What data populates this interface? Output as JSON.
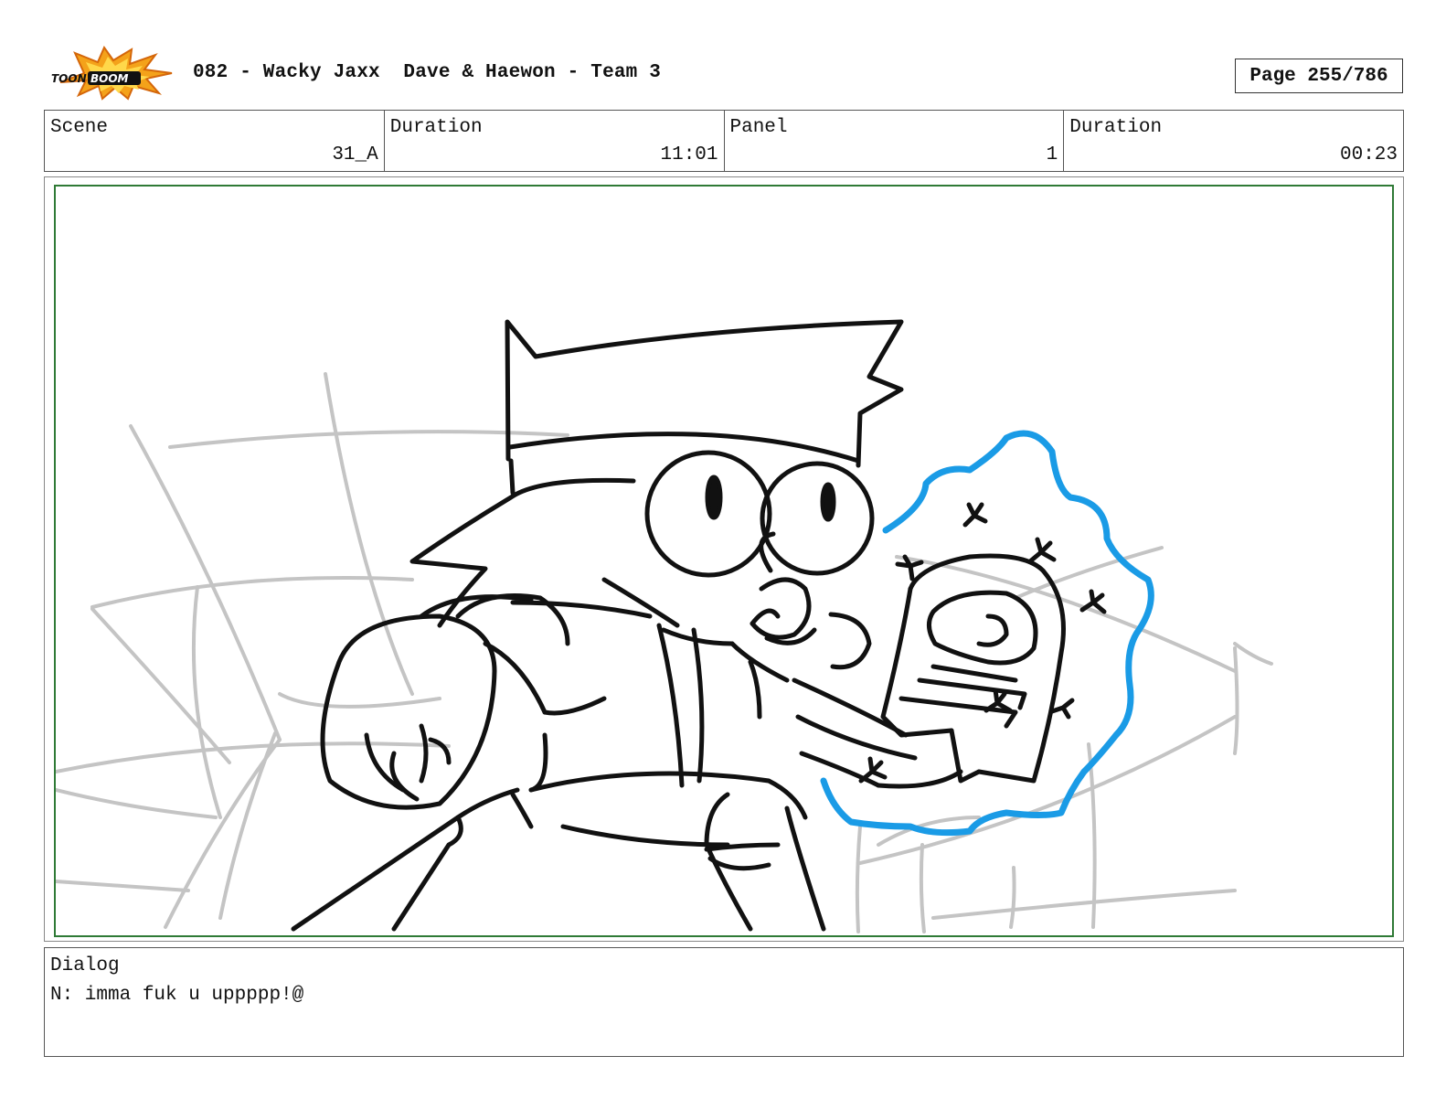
{
  "header": {
    "logo_text": "TOON BOOM",
    "title": "082 - Wacky Jaxx  Dave & Haewon - Team 3",
    "page": "Page 255/786"
  },
  "info": {
    "scene_label": "Scene",
    "scene_value": "31_A",
    "duration_label": "Duration",
    "duration_value": "11:01",
    "panel_label": "Panel",
    "panel_value": "1",
    "panel_duration_label": "Duration",
    "panel_duration_value": "00:23"
  },
  "dialog": {
    "label": "Dialog",
    "text": "N: imma fuk u uppppp!@"
  },
  "colors": {
    "frame_border": "#2f7a36",
    "glow": "#1a9be6",
    "sketch_gray": "#c4c4c4"
  }
}
